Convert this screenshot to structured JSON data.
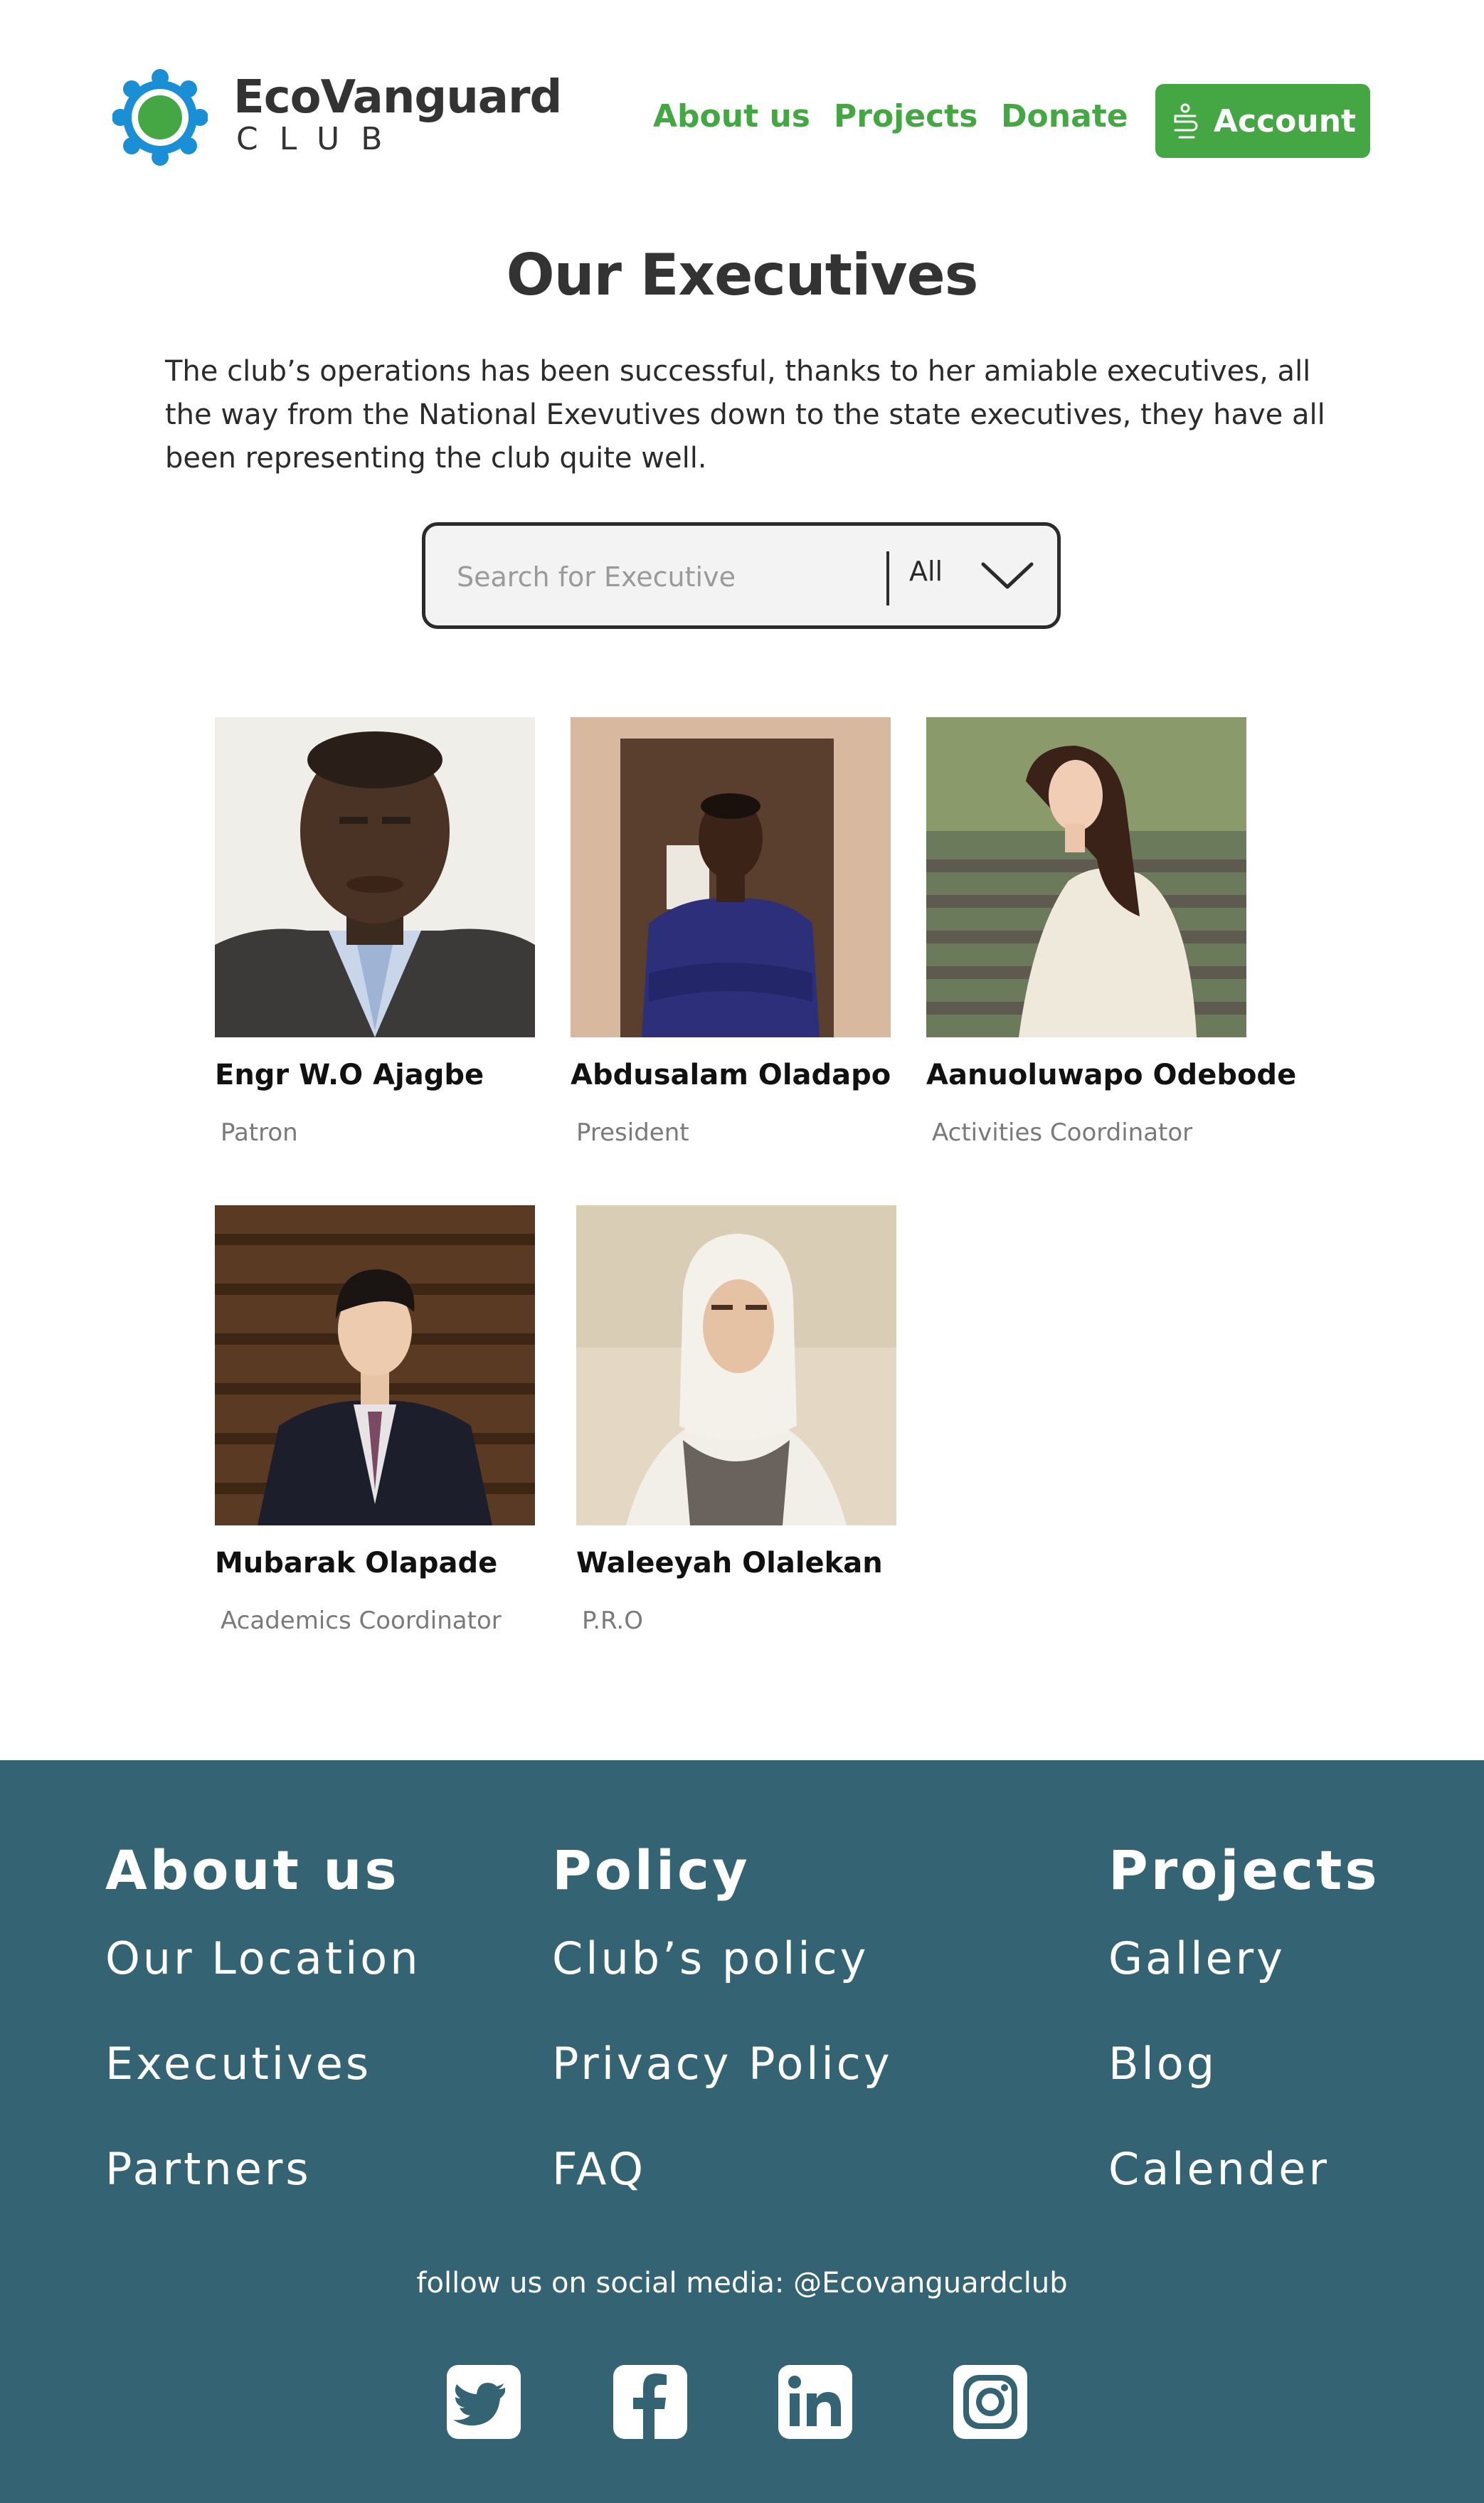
{
  "header": {
    "logo_name": "EcoVanguard",
    "logo_sub": "CLUB",
    "nav": {
      "about": "About us",
      "projects": "Projects",
      "donate": "Donate",
      "account": "Account"
    },
    "brand_color": "#45a744",
    "logo_ring_color": "#1a8fd6"
  },
  "main": {
    "title": "Our Executives",
    "intro": "The club’s operations has been successful, thanks to her amiable executives, all the way from the National Exevutives down to the state executives,  they have all been representing the club quite well.",
    "search": {
      "placeholder": "Search for Executive",
      "filter_value": "All"
    },
    "executives": [
      {
        "name": "Engr W.O Ajagbe",
        "role": "Patron"
      },
      {
        "name": "Abdusalam Oladapo",
        "role": "President"
      },
      {
        "name": "Aanuoluwapo Odebode",
        "role": "Activities Coordinator"
      },
      {
        "name": "Mubarak Olapade",
        "role": "Academics Coordinator"
      },
      {
        "name": "Waleeyah Olalekan",
        "role": "P.R.O"
      }
    ]
  },
  "footer": {
    "background": "#346473",
    "columns": [
      {
        "heading": "About us",
        "links": [
          "Our Location",
          "Executives",
          "Partners"
        ]
      },
      {
        "heading": "Policy",
        "links": [
          "Club’s policy",
          "Privacy Policy",
          "FAQ"
        ]
      },
      {
        "heading": "Projects",
        "links": [
          "Gallery",
          "Blog",
          "Calender"
        ]
      }
    ],
    "follow": "follow us on social media: @Ecovanguardclub",
    "socials": [
      "twitter-icon",
      "facebook-icon",
      "linkedin-icon",
      "instagram-icon"
    ]
  }
}
